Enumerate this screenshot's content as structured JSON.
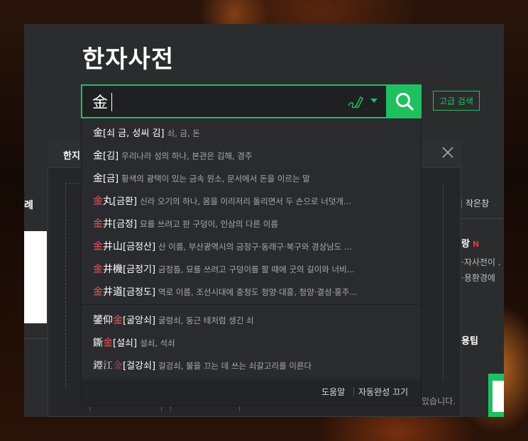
{
  "title": "한자사전",
  "search": {
    "value": "金",
    "advanced_label": "고급 검색"
  },
  "icons": {
    "handwriting": "handwriting-input-icon",
    "dropdown": "chevron-down-icon",
    "search": "search-icon",
    "close": "close-icon"
  },
  "colors": {
    "accent": "#1ec05f",
    "highlight": "#f2525a",
    "panel": "#2b2c2e"
  },
  "background": {
    "sub_tab": "한지",
    "left_label": "례",
    "small_window": "작은창",
    "hot_label": "랑",
    "hot_badge": "N",
    "text1": "·자사전이 .",
    "text2": "·용환경에",
    "tip": "용팁",
    "bottom_note": "있습니다."
  },
  "autocomplete": {
    "items": [
      {
        "head": "金",
        "red": "",
        "tail": "",
        "reading": "[쇠 금, 성씨 김]",
        "meaning": "쇠, 금, 돈"
      },
      {
        "head": "金",
        "red": "",
        "tail": "",
        "reading": "[김]",
        "meaning": "우리나라 성의 하나, 본관은 김해, 경주"
      },
      {
        "head": "金",
        "red": "",
        "tail": "",
        "reading": "[금]",
        "meaning": "황색의 광택이 있는 금속 원소, 문서에서 돈을 이르는 말"
      },
      {
        "head": "",
        "red": "金",
        "tail": "丸",
        "reading": "[금환]",
        "meaning": "신라 오기의 하나, 몸을 이리저리 돌리면서 두 손으로 너덧개..."
      },
      {
        "head": "",
        "red": "金",
        "tail": "井",
        "reading": "[금정]",
        "meaning": "묘를 쓰려고 판 구덩이, 인삼의 다른 이름"
      },
      {
        "head": "",
        "red": "金",
        "tail": "井山",
        "reading": "[금정산]",
        "meaning": "산 이름, 부산광역시의 금정구·동래구·북구와 경상남도 ..."
      },
      {
        "head": "",
        "red": "金",
        "tail": "井機",
        "reading": "[금정기]",
        "meaning": "금정틀, 묘를 쓰려고 구덩이를 팔 때에 굿의 길이와 너비..."
      },
      {
        "head": "",
        "red": "金",
        "tail": "井道",
        "reading": "[금정도]",
        "meaning": "역로 이름, 조선시대에 충청도 청양·대흥, 청양·결성·홍주..."
      },
      {
        "head": "𨭉仰",
        "red": "金",
        "tail": "",
        "reading": "[굴앙쇠]",
        "meaning": "굴렁쇠, 둥근 테처럼 생긴 쇠"
      },
      {
        "head": "鐁",
        "red": "金",
        "tail": "",
        "reading": "[설쇠]",
        "meaning": "설쇠, 석쇠"
      },
      {
        "head": "𨪐江",
        "red": "金",
        "tail": "",
        "reading": "[걸강쇠]",
        "meaning": "걸겅쇠, 불을 끄는 데 쓰는 쇠갈고리를 이른다"
      }
    ],
    "help_label": "도움말",
    "autocomplete_off_label": "자동완성 끄기"
  }
}
